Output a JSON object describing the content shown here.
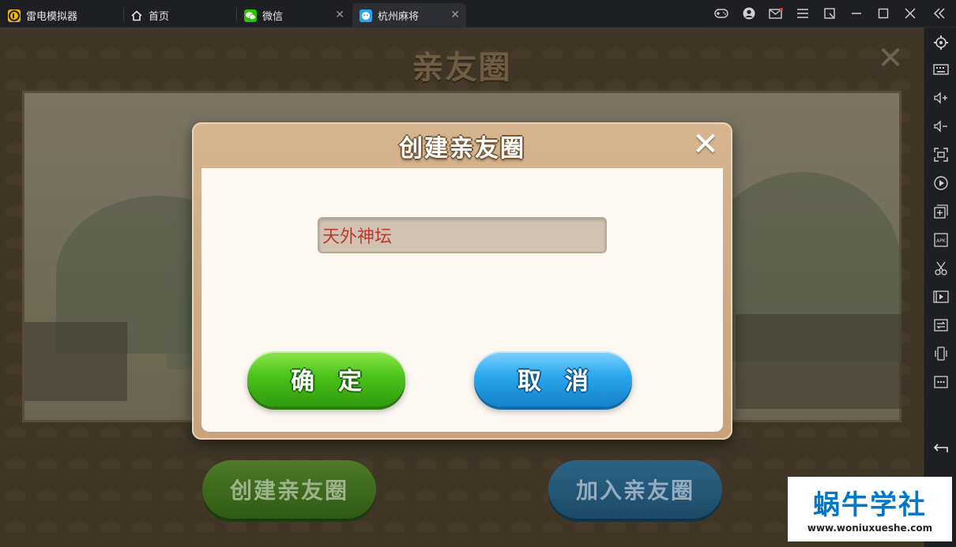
{
  "titlebar": {
    "tabs": [
      {
        "label": "雷电模拟器",
        "icon": "ldplayer-logo-icon",
        "active": false,
        "closable": false
      },
      {
        "label": "首页",
        "icon": "home-icon",
        "active": false,
        "closable": false
      },
      {
        "label": "微信",
        "icon": "wechat-icon",
        "active": false,
        "closable": true
      },
      {
        "label": "杭州麻将",
        "icon": "game-app-icon",
        "active": true,
        "closable": true
      }
    ],
    "close_glyph": "✕",
    "window_buttons": [
      "gamepad-icon",
      "user-avatar-icon",
      "mail-icon",
      "menu-icon",
      "pin-icon",
      "minimize-icon",
      "maximize-icon",
      "close-icon",
      "collapse-sidebar-icon"
    ]
  },
  "sidebar": {
    "buttons": [
      "settings-icon",
      "keyboard-icon",
      "volume-up-icon",
      "volume-down-icon",
      "fullscreen-icon",
      "record-icon",
      "add-window-icon",
      "apk-install-icon",
      "screenshot-scissors-icon",
      "video-icon",
      "sync-icon",
      "shake-icon",
      "more-icon",
      "back-icon"
    ]
  },
  "background": {
    "title": "亲友圈",
    "close_glyph": "✕",
    "create_button": "创建亲友圈",
    "join_button": "加入亲友圈"
  },
  "dialog": {
    "title": "创建亲友圈",
    "close_glyph": "✕",
    "name_value": "天外神坛",
    "confirm_label": "确定",
    "cancel_label": "取消"
  },
  "watermark": {
    "title": "蜗牛学社",
    "url": "www.woniuxueshe.com"
  },
  "colors": {
    "titlebar_bg": "#1e1f22",
    "dialog_frame": "#d6b58f",
    "input_text": "#c0392b",
    "confirm_green": "#4cc21a",
    "cancel_blue": "#2aa6ec",
    "watermark_blue": "#0077c8"
  }
}
